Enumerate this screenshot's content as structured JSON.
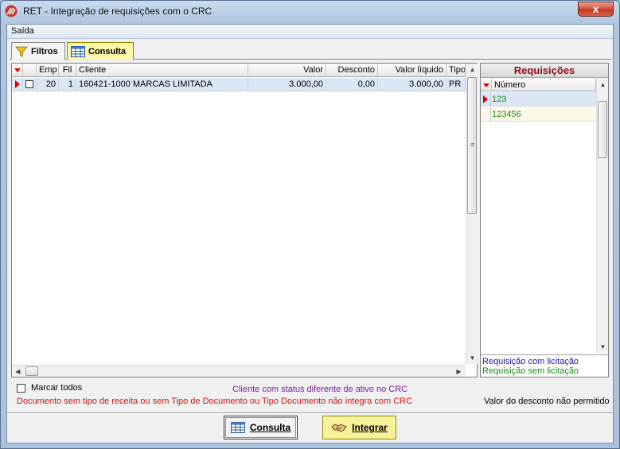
{
  "window": {
    "title": "RET - Integração de requisições com o CRC",
    "close_symbol": "x"
  },
  "menu": {
    "items": [
      "Saída"
    ]
  },
  "tabs": [
    {
      "label": "Filtros",
      "icon": "funnel-icon",
      "active": false
    },
    {
      "label": "Consulta",
      "icon": "table-icon",
      "active": true
    }
  ],
  "grid": {
    "columns": [
      "Emp",
      "Fil",
      "Cliente",
      "Valor",
      "Desconto",
      "Valor líquido",
      "Tipo"
    ],
    "rows": [
      {
        "emp": "20",
        "fil": "1",
        "cliente": "160421-1000 MARCAS LIMITADA",
        "valor": "3.000,00",
        "desconto": "0,00",
        "valor_liquido": "3.000,00",
        "tipo": "PR"
      }
    ]
  },
  "requisicoes": {
    "title": "Requisições",
    "column": "Número",
    "rows": [
      "123",
      "123456"
    ],
    "legend_com": "Requisição com licitação",
    "legend_sem": "Requisição sem licitação"
  },
  "status": {
    "marcar_todos": "Marcar todos",
    "cliente_status": "Cliente com status diferente de ativo no CRC",
    "documento_msg": "Documento sem tipo de receita ou sem Tipo de Documento ou Tipo Documento não integra com CRC",
    "desconto_msg": "Valor do desconto não permitido"
  },
  "buttons": {
    "consulta": "Consulta",
    "integrar": "Integrar"
  },
  "colors": {
    "purple_text": "#7a1fa0",
    "red_text": "#c81414",
    "blue_text": "#1a1aa0",
    "green_text": "#1a8a1a",
    "title_red": "#8b1010",
    "highlight_yellow": "#fbf6a8"
  }
}
